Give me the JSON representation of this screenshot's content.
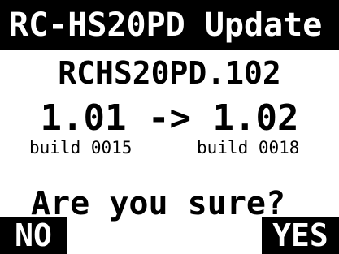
{
  "header": {
    "title": "RC-HS20PD Update"
  },
  "update": {
    "filename": "RCHS20PD.102",
    "from_version": "1.01",
    "arrow": "->",
    "to_version": "1.02",
    "from_build": "build 0015",
    "to_build": "build 0018"
  },
  "prompt": {
    "text": "Are you sure?"
  },
  "softkeys": {
    "left": "NO",
    "right": "YES"
  },
  "colors": {
    "background": "#ffffff",
    "foreground": "#000000",
    "inverse_text": "#ffffff"
  }
}
